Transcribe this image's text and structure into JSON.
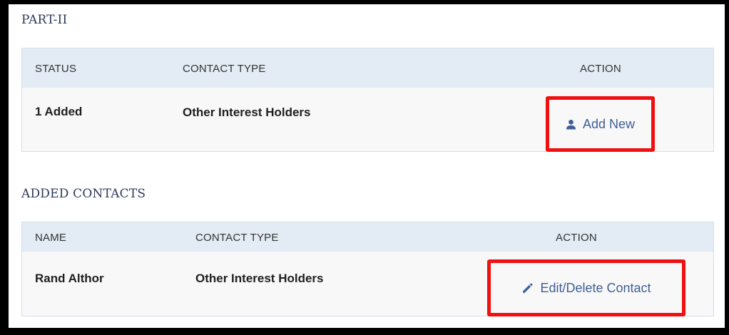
{
  "part2": {
    "title": "PART-II",
    "headers": {
      "status": "STATUS",
      "contact_type": "CONTACT TYPE",
      "action": "ACTION"
    },
    "row": {
      "status": "1 Added",
      "contact_type": "Other Interest Holders",
      "action_label": "Add New",
      "action_icon": "person-icon"
    }
  },
  "added_contacts": {
    "title": "ADDED CONTACTS",
    "headers": {
      "name": "NAME",
      "contact_type": "CONTACT TYPE",
      "action": "ACTION"
    },
    "row": {
      "name": "Rand Althor",
      "contact_type": "Other Interest Holders",
      "action_label": "Edit/Delete Contact",
      "action_icon": "pencil-icon"
    }
  },
  "colors": {
    "highlight": "#ef1010",
    "link": "#3f5f96",
    "header_bg": "#e3ecf4"
  }
}
